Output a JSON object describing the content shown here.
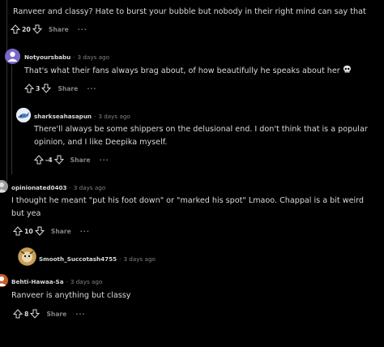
{
  "comments": [
    {
      "text": "Ranveer and classy? Hate to burst your bubble but nobody in their right mind can say that",
      "score": "20",
      "share": "Share",
      "more": "···"
    },
    {
      "author": "Notyoursbabu",
      "time": "3 days ago",
      "text": "That's what their fans always brag about, of how beautifully he speaks about her",
      "score": "3",
      "share": "Share",
      "more": "···"
    },
    {
      "author": "sharkseahasapun",
      "time": "3 days ago",
      "text": "There'll always be some shippers on the delusional end. I don't think that is a popular opinion, and I like Deepika myself.",
      "score": "-4",
      "share": "Share",
      "more": "···"
    },
    {
      "author": "opinionated0403",
      "time": "3 days ago",
      "text": "I thought he meant \"put his foot down\" or \"marked his spot\" Lmaoo. Chappal is a bit weird but yea",
      "score": "10",
      "share": "Share",
      "more": "···"
    },
    {
      "author": "Smooth_Succotash4755",
      "time": "3 days ago"
    },
    {
      "author": "Behti-Hawaa-Sa",
      "time": "3 days ago",
      "text": "Ranveer is anything but classy",
      "score": "8",
      "share": "Share",
      "more": "···"
    }
  ],
  "separator": "·",
  "colors": {
    "background": "#000000",
    "text": "#d7dadc",
    "muted": "#818384",
    "avatar_purple": "#7b68c9"
  }
}
